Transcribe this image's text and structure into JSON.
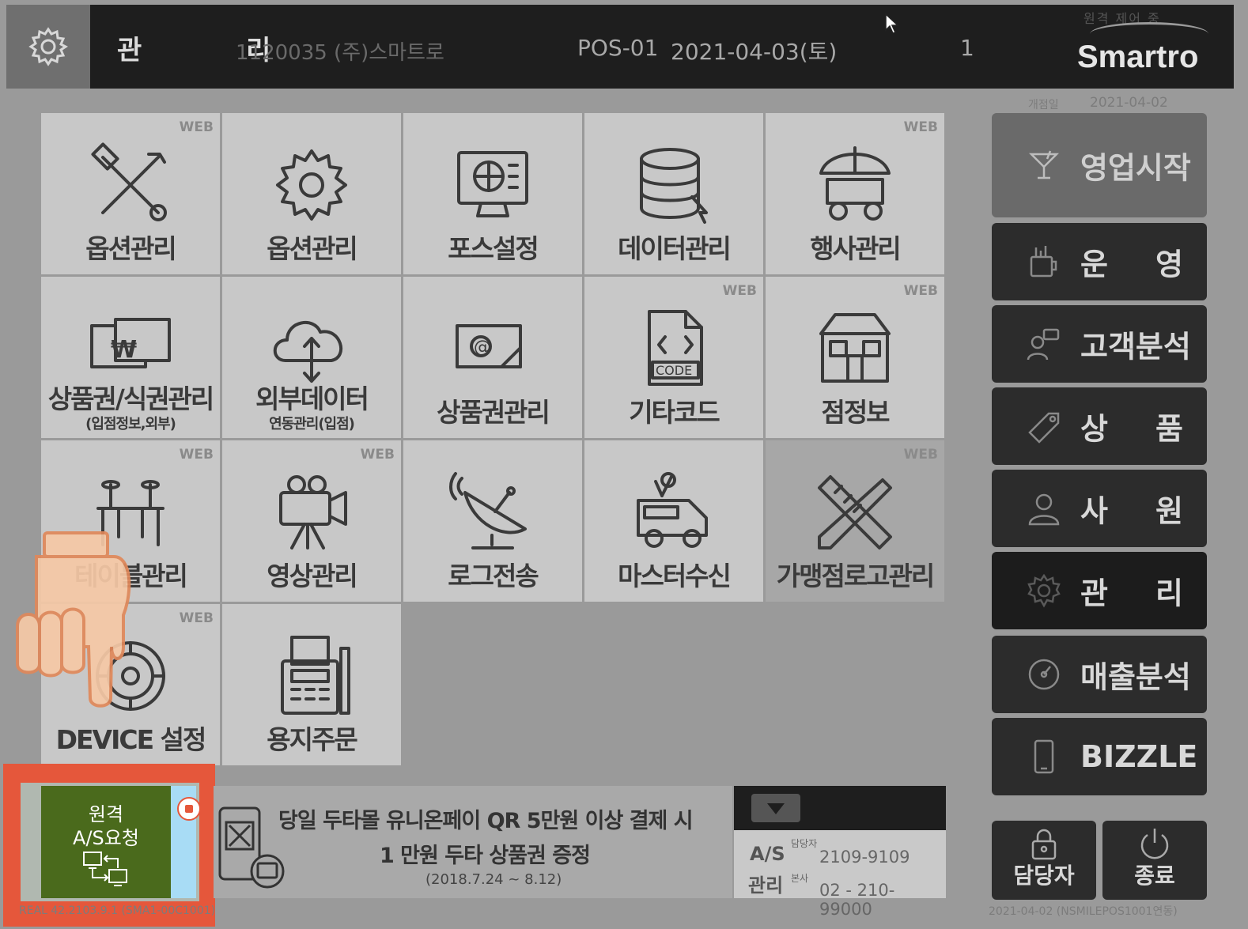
{
  "header": {
    "title": "관 리",
    "store": "1120035 (주)스마트로",
    "pos": "POS-01",
    "date": "2021-04-03(토)",
    "time": "",
    "number": "1",
    "remote_status": "원격 제어 중",
    "logo": "Smartro"
  },
  "grid": {
    "tiles": [
      {
        "label": "옵션관리",
        "sub": "",
        "web": "WEB",
        "icon": "tools-icon"
      },
      {
        "label": "옵션관리",
        "sub": "",
        "web": "",
        "icon": "gear-icon"
      },
      {
        "label": "포스설정",
        "sub": "",
        "web": "",
        "icon": "monitor-globe-icon"
      },
      {
        "label": "데이터관리",
        "sub": "",
        "web": "",
        "icon": "database-icon"
      },
      {
        "label": "행사관리",
        "sub": "",
        "web": "WEB",
        "icon": "stall-icon"
      },
      {
        "label": "상품권/식권관리",
        "sub": "(입점정보,외부)",
        "web": "",
        "icon": "voucher-icon"
      },
      {
        "label": "외부데이터",
        "sub": "연동관리(입점)",
        "web": "",
        "icon": "cloud-sync-icon"
      },
      {
        "label": "상품권관리",
        "sub": "",
        "web": "",
        "icon": "gift-card-icon"
      },
      {
        "label": "기타코드",
        "sub": "",
        "web": "WEB",
        "icon": "code-file-icon"
      },
      {
        "label": "점정보",
        "sub": "",
        "web": "WEB",
        "icon": "store-icon"
      },
      {
        "label": "테이블관리",
        "sub": "",
        "web": "WEB",
        "icon": "table-icon"
      },
      {
        "label": "영상관리",
        "sub": "",
        "web": "WEB",
        "icon": "camera-icon"
      },
      {
        "label": "로그전송",
        "sub": "",
        "web": "",
        "icon": "satellite-icon"
      },
      {
        "label": "마스터수신",
        "sub": "",
        "web": "",
        "icon": "van-icon"
      },
      {
        "label": "가맹점로고관리",
        "sub": "",
        "web": "WEB",
        "icon": "pencil-ruler-icon"
      },
      {
        "label": "DEVICE 설정",
        "sub": "",
        "web": "WEB",
        "icon": "device-icon"
      },
      {
        "label": "용지주문",
        "sub": "",
        "web": "",
        "icon": "receipt-printer-icon"
      }
    ]
  },
  "side": {
    "open_date_label": "개점일",
    "open_date": "2021-04-02",
    "menu": [
      {
        "label": "영업시작",
        "icon": "cocktail-icon"
      },
      {
        "label_a": "운",
        "label_b": "영",
        "icon": "cup-icon"
      },
      {
        "label": "고객분석",
        "icon": "customer-chat-icon"
      },
      {
        "label_a": "상",
        "label_b": "품",
        "icon": "tag-icon"
      },
      {
        "label_a": "사",
        "label_b": "원",
        "icon": "person-icon"
      },
      {
        "label_a": "관",
        "label_b": "리",
        "icon": "gear-icon"
      },
      {
        "label": "매출분석",
        "icon": "gauge-icon"
      },
      {
        "label": "BIZZLE",
        "icon": "phone-icon"
      }
    ],
    "manager_label": "담당자",
    "exit_label": "종료",
    "footer": "2021-04-02 (NSMILEPOS1001연동)"
  },
  "remote": {
    "line1": "원격",
    "line2": "A/S요청"
  },
  "banner": {
    "line1": "당일 두타몰 유니온페이 QR 5만원 이상 결제 시",
    "line2": "1 만원 두타 상품권 증정",
    "line3": "(2018.7.24 ~ 8.12)"
  },
  "as_panel": {
    "as_label": "A/S",
    "manager_small": "담당자",
    "manager_phone": "2109-9109",
    "admin_label": "관리",
    "hq_small": "본사",
    "hq_phone": "02 - 210-99000"
  },
  "footer_left": "REAL 42.2103.9.1 (SMA1-00C1001)"
}
